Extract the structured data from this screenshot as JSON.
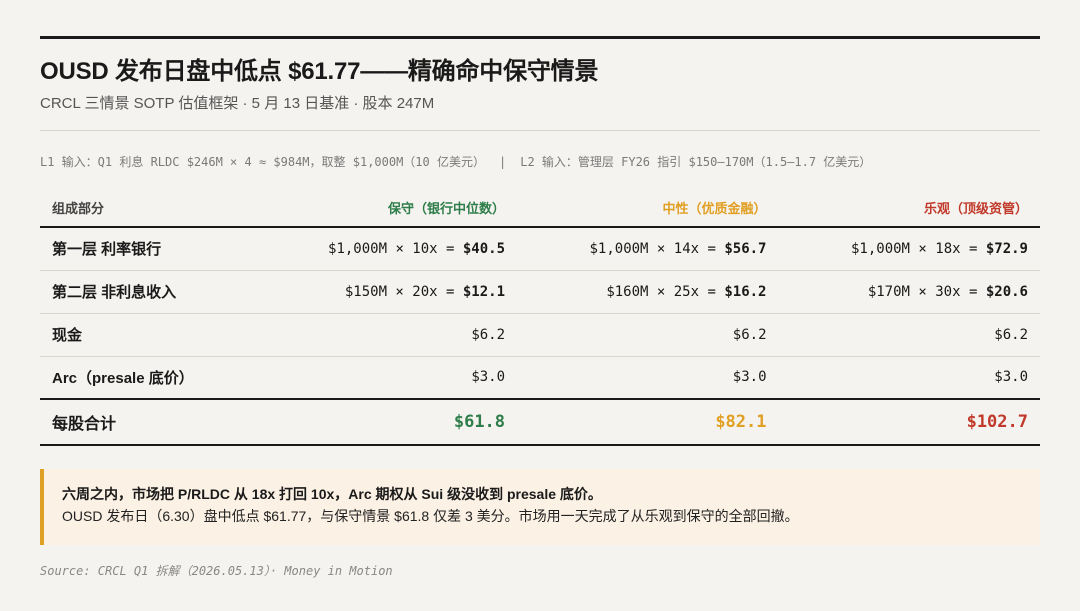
{
  "title": "OUSD 发布日盘中低点 $61.77——精确命中保守情景",
  "subtitle": "CRCL 三情景 SOTP 估值框架 · 5 月 13 日基准 · 股本 247M",
  "inputs": {
    "l1": "L1 输入：Q1 利息 RLDC $246M × 4 ≈ $984M，取整 $1,000M（10 亿美元）",
    "separator": "|",
    "l2": "L2 输入：管理层 FY26 指引 $150–170M（1.5–1.7 亿美元）"
  },
  "table": {
    "headers": [
      "组成部分",
      "保守（银行中位数）",
      "中性（优质金融）",
      "乐观（顶级资管）"
    ],
    "rows": [
      {
        "label": "第一层 利率银行",
        "cells": [
          {
            "formula": "$1,000M × 10x = ",
            "result": "$40.5"
          },
          {
            "formula": "$1,000M × 14x = ",
            "result": "$56.7"
          },
          {
            "formula": "$1,000M × 18x = ",
            "result": "$72.9"
          }
        ]
      },
      {
        "label": "第二层 非利息收入",
        "cells": [
          {
            "formula": "$150M × 20x = ",
            "result": "$12.1"
          },
          {
            "formula": "$160M × 25x = ",
            "result": "$16.2"
          },
          {
            "formula": "$170M × 30x = ",
            "result": "$20.6"
          }
        ]
      },
      {
        "label": "现金",
        "cells": [
          {
            "formula": "$6.2",
            "result": ""
          },
          {
            "formula": "$6.2",
            "result": ""
          },
          {
            "formula": "$6.2",
            "result": ""
          }
        ]
      },
      {
        "label": "Arc（presale 底价）",
        "cells": [
          {
            "formula": "$3.0",
            "result": ""
          },
          {
            "formula": "$3.0",
            "result": ""
          },
          {
            "formula": "$3.0",
            "result": ""
          }
        ]
      }
    ],
    "total": {
      "label": "每股合计",
      "values": [
        "$61.8",
        "$82.1",
        "$102.7"
      ]
    }
  },
  "callout": {
    "line1": "六周之内，市场把 P/RLDC 从 18x 打回 10x，Arc 期权从 Sui 级没收到 presale 底价。",
    "line2": "OUSD 发布日（6.30）盘中低点 $61.77，与保守情景 $61.8 仅差 3 美分。市场用一天完成了从乐观到保守的全部回撤。"
  },
  "source": "Source: CRCL Q1 拆解（2026.05.13）· Money in Motion",
  "colors": {
    "conservative": "#2e7d4a",
    "neutral": "#e0a024",
    "optimistic": "#c0392b"
  }
}
